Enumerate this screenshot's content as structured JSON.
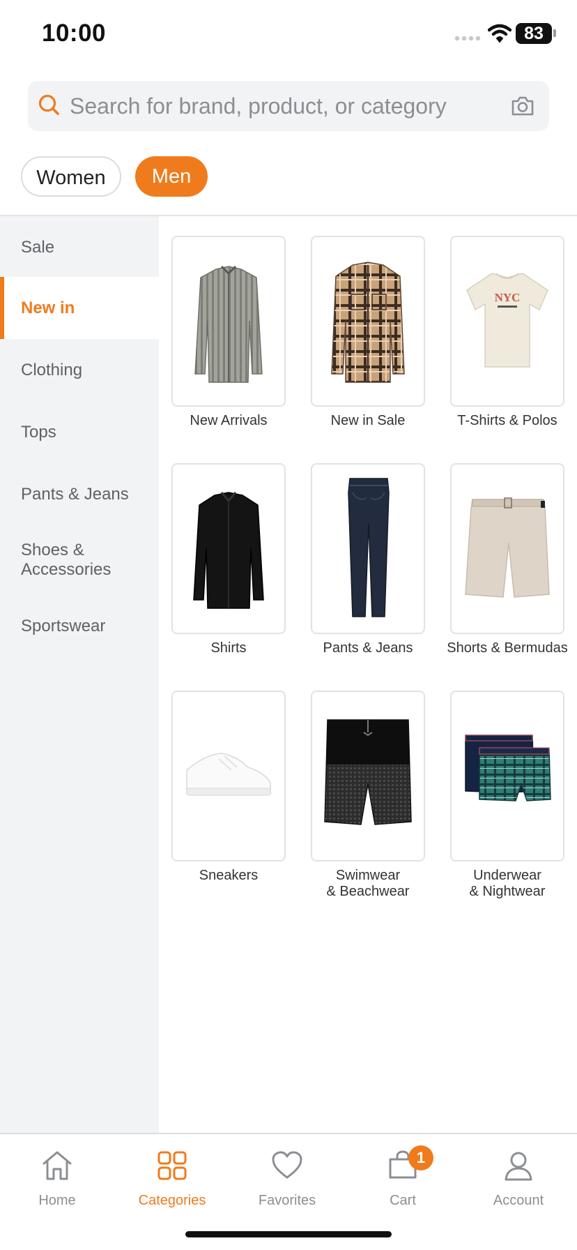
{
  "status_bar": {
    "time": "10:00",
    "battery": "83"
  },
  "search": {
    "placeholder": "Search for brand, product, or category"
  },
  "gender_tabs": [
    {
      "label": "Women",
      "active": false
    },
    {
      "label": "Men",
      "active": true
    }
  ],
  "sidebar": {
    "items": [
      {
        "label": "Sale"
      },
      {
        "label": "New in",
        "active": true
      },
      {
        "label": "Clothing"
      },
      {
        "label": "Tops"
      },
      {
        "label": "Pants & Jeans"
      },
      {
        "label": "Shoes & Accessories"
      },
      {
        "label": "Sportswear"
      }
    ]
  },
  "grid": {
    "items": [
      {
        "label": "New Arrivals",
        "icon": "striped-shirt"
      },
      {
        "label": "New in Sale",
        "icon": "plaid-overshirt"
      },
      {
        "label": "T-Shirts & Polos",
        "icon": "tshirt",
        "print": "NYC"
      },
      {
        "label": "Shirts",
        "icon": "black-shirt"
      },
      {
        "label": "Pants & Jeans",
        "icon": "jeans"
      },
      {
        "label": "Shorts & Bermudas",
        "icon": "shorts"
      },
      {
        "label": "Sneakers",
        "icon": "sneaker"
      },
      {
        "label": "Swimwear\n& Beachwear",
        "icon": "swim-shorts"
      },
      {
        "label": "Underwear\n& Nightwear",
        "icon": "boxers"
      }
    ]
  },
  "bottom_nav": {
    "items": [
      {
        "label": "Home",
        "icon": "home-icon"
      },
      {
        "label": "Categories",
        "icon": "grid-icon",
        "active": true
      },
      {
        "label": "Favorites",
        "icon": "heart-icon"
      },
      {
        "label": "Cart",
        "icon": "cart-icon",
        "badge": "1"
      },
      {
        "label": "Account",
        "icon": "user-icon"
      }
    ]
  },
  "colors": {
    "accent": "#f07b1c",
    "sidebar_bg": "#f1f3f5",
    "muted_text": "#8b8e93"
  }
}
